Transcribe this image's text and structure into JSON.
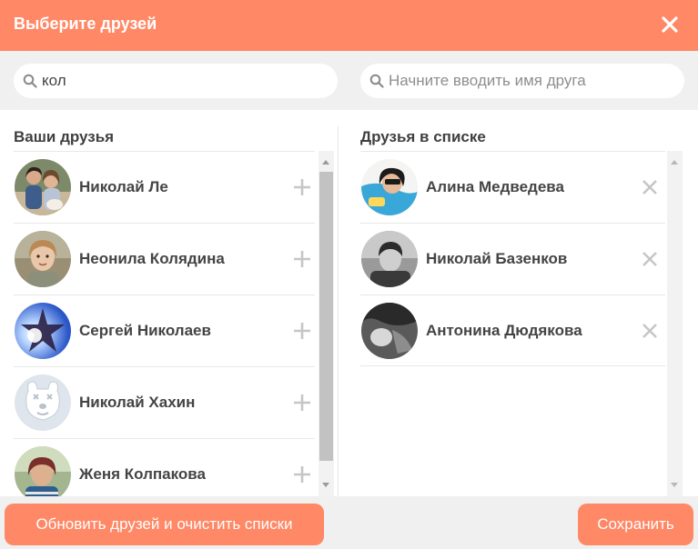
{
  "dialog": {
    "title": "Выберите друзей"
  },
  "search": {
    "left_value": "кол",
    "right_placeholder": "Начните вводить имя друга"
  },
  "columns": {
    "left_title": "Ваши друзья",
    "right_title": "Друзья в списке"
  },
  "your_friends": [
    {
      "name": "Николай Ле",
      "avatar": "couple-photo"
    },
    {
      "name": "Неонила Колядина",
      "avatar": "woman-photo"
    },
    {
      "name": "Сергей Николаев",
      "avatar": "star-photo"
    },
    {
      "name": "Николай Хахин",
      "avatar": "default-dog-avatar"
    },
    {
      "name": "Женя Колпакова",
      "avatar": "woman-tree-photo"
    }
  ],
  "list_friends": [
    {
      "name": "Алина Медведева",
      "avatar": "girl-photo"
    },
    {
      "name": "Николай Базенков",
      "avatar": "man-bw-photo"
    },
    {
      "name": "Антонина Дюдякова",
      "avatar": "bw-photo"
    }
  ],
  "footer": {
    "reset_label": "Обновить друзей и очистить списки",
    "save_label": "Сохранить"
  },
  "colors": {
    "accent": "#ff8866",
    "panel": "#f0f0f0"
  }
}
